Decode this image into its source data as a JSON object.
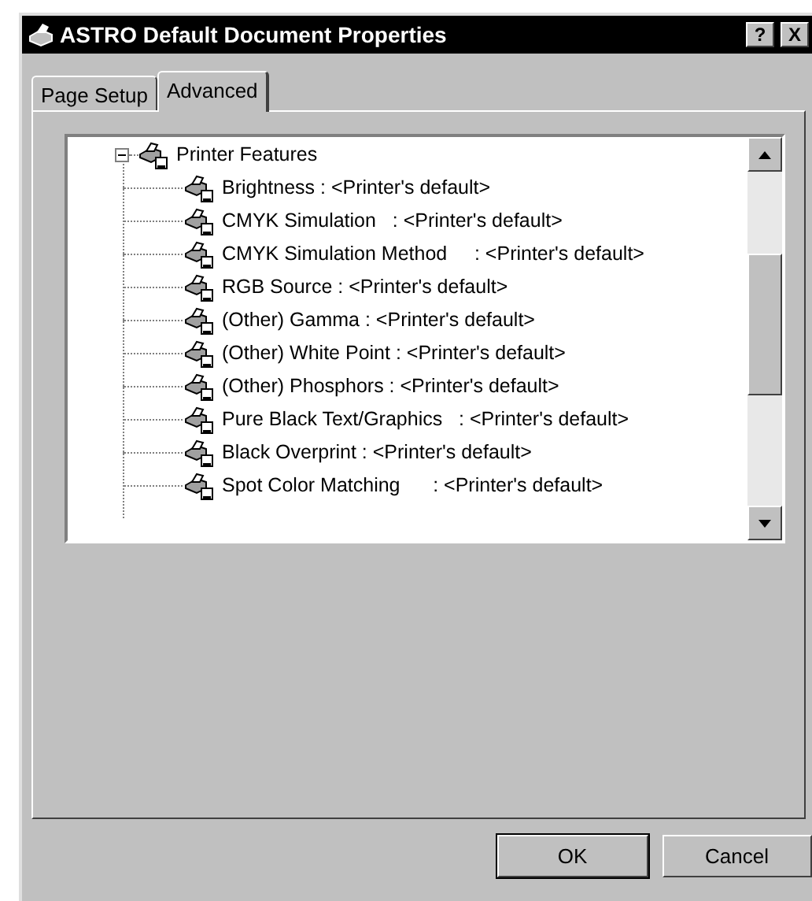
{
  "window": {
    "title": "ASTRO Default Document Properties",
    "title_buttons": [
      "?",
      "X"
    ]
  },
  "tabs": [
    {
      "label": "Page Setup",
      "selected": false
    },
    {
      "label": "Advanced",
      "selected": true
    }
  ],
  "tree": [
    {
      "label": "Printer Features",
      "expanded": true,
      "children": [
        {
          "label": "Brightness : <Printer's default>"
        },
        {
          "label": "CMYK Simulation   : <Printer's default>"
        },
        {
          "label": "CMYK Simulation Method     : <Printer's default>"
        },
        {
          "label": "RGB Source : <Printer's default>"
        },
        {
          "label": "(Other) Gamma : <Printer's default>"
        },
        {
          "label": "(Other) White Point : <Printer's default>"
        },
        {
          "label": "(Other) Phosphors : <Printer's default>"
        },
        {
          "label": "Pure Black Text/Graphics   : <Printer's default>"
        },
        {
          "label": "Black Overprint : <Printer's default>"
        },
        {
          "label": "Spot Color Matching      : <Printer's default>"
        }
      ]
    }
  ],
  "buttons": [
    {
      "label": "OK",
      "default": true
    },
    {
      "label": "Cancel",
      "default": false
    }
  ]
}
